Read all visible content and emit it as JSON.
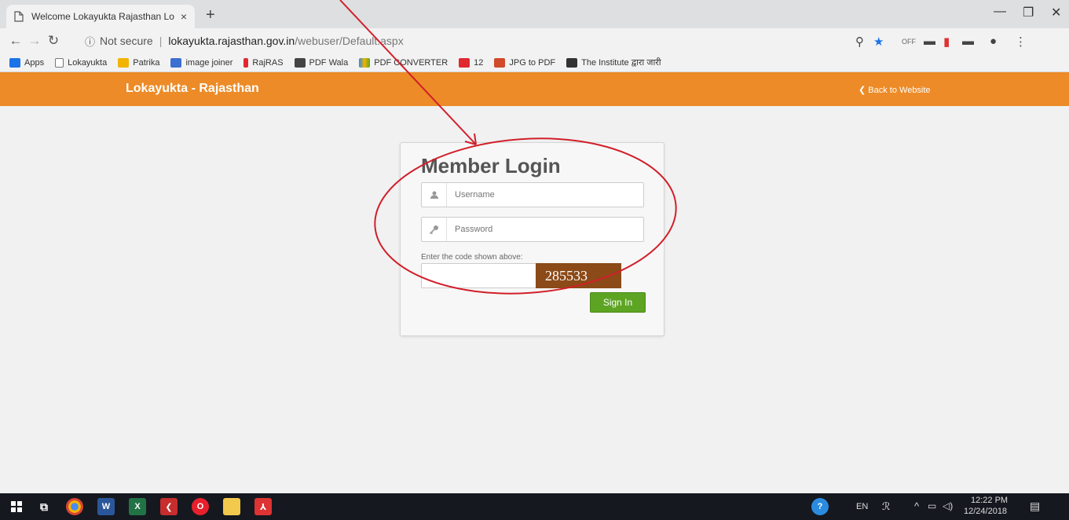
{
  "browser": {
    "tab_title": "Welcome Lokayukta Rajasthan Lo",
    "tab_close": "×",
    "new_tab": "+",
    "minimize": "—",
    "restore": "❐",
    "close": "✕",
    "security_label": "Not secure",
    "url_host": "lokayukta.rajasthan.gov.in",
    "url_path": "/webuser/Default.aspx"
  },
  "bookmarks": [
    {
      "label": "Apps",
      "color": "#1a73e8"
    },
    {
      "label": "Lokayukta",
      "color": "#ffffff"
    },
    {
      "label": "Patrika",
      "color": "#f2b400"
    },
    {
      "label": "image joiner",
      "color": "#3b6fd1"
    },
    {
      "label": "RajRAS",
      "color": "#e0282e"
    },
    {
      "label": "PDF Wala",
      "color": "#444444"
    },
    {
      "label": "PDF CONVERTER",
      "color": "#2b8be0"
    },
    {
      "label": "12",
      "color": "#e0282e"
    },
    {
      "label": "JPG to PDF",
      "color": "#d04a2b"
    },
    {
      "label": "The Institute द्वारा जारी",
      "color": "#333333"
    }
  ],
  "site": {
    "brand": "Lokayukta - Rajasthan",
    "back_link": "❮ Back to Website",
    "header_color": "#ec8b27"
  },
  "login": {
    "title": "Member Login",
    "username_placeholder": "Username",
    "password_placeholder": "Password",
    "code_label": "Enter the code shown above:",
    "captcha": "285533",
    "signin_label": "Sign In",
    "signin_color": "#5da423"
  },
  "annotation": {
    "color": "#d11f2a"
  },
  "taskbar": {
    "lang": "EN",
    "time": "12:22 PM",
    "date": "12/24/2018"
  }
}
